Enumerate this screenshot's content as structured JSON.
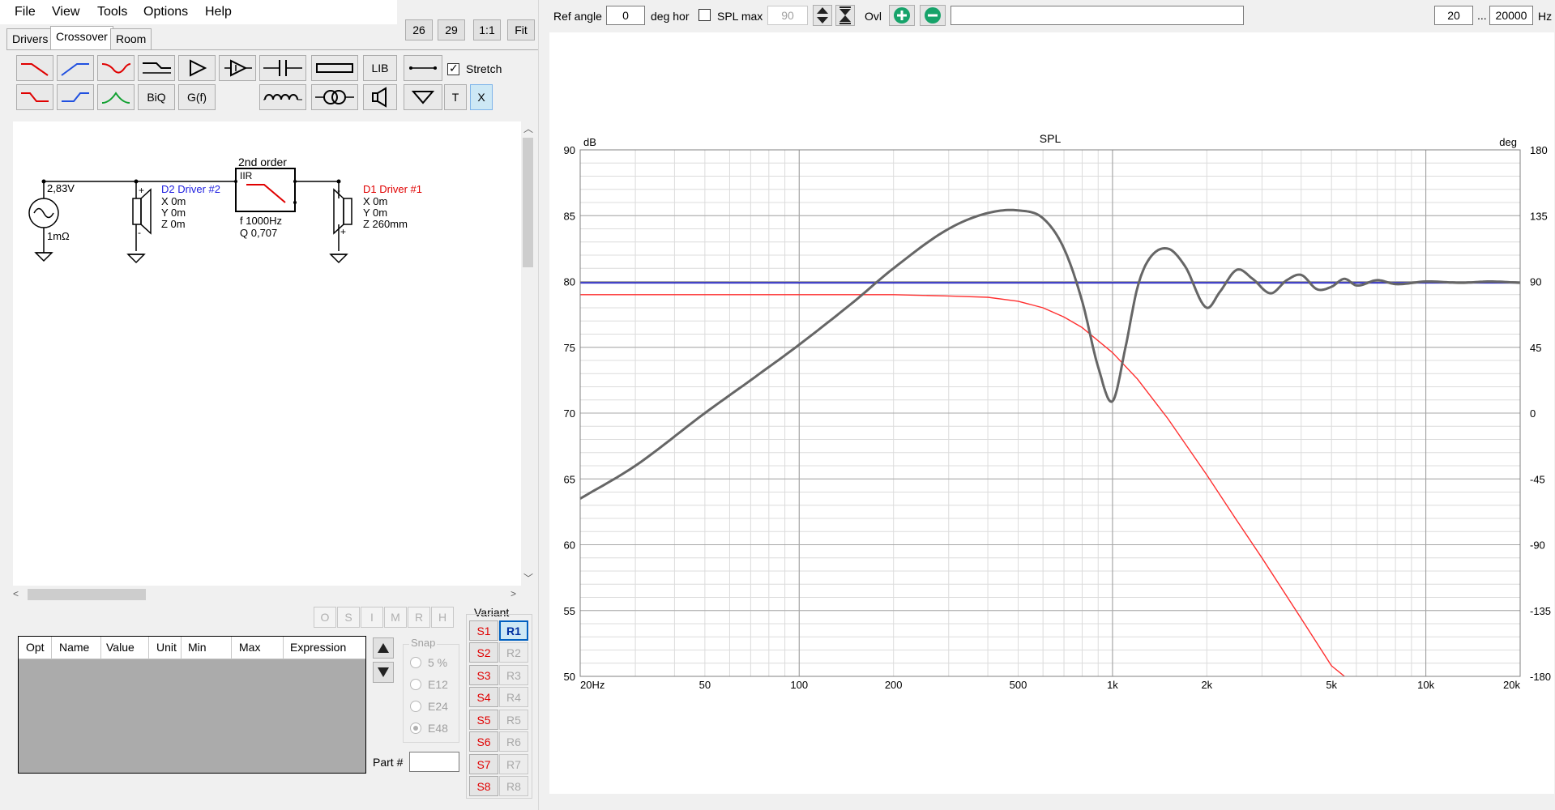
{
  "menu": [
    "File",
    "View",
    "Tools",
    "Options",
    "Help"
  ],
  "tabs": [
    "Drivers",
    "Crossover",
    "Room"
  ],
  "top_buttons": {
    "b26": "26",
    "b29": "29",
    "one_to_one": "1:1",
    "fit": "Fit"
  },
  "toolbar": {
    "lib": "LIB",
    "stretch_label": "Stretch",
    "biq": "BiQ",
    "gf": "G(f)",
    "t": "T",
    "x": "X"
  },
  "schematic": {
    "order_label": "2nd order",
    "voltage": "2,83V",
    "source_res": "1mΩ",
    "driver2": {
      "name": "D2 Driver #2",
      "x": "X 0m",
      "y": "Y 0m",
      "z": "Z 0m"
    },
    "iir": {
      "label": "IIR",
      "f": "f  1000Hz",
      "q": "Q 0,707"
    },
    "driver1": {
      "name": "D1 Driver #1",
      "x": "X 0m",
      "y": "Y 0m",
      "z": "Z 260mm"
    }
  },
  "opt_buttons": [
    "O",
    "S",
    "I",
    "M",
    "R",
    "H"
  ],
  "param_table": {
    "headers": [
      "Opt",
      "Name",
      "Value",
      "Unit",
      "Min",
      "Max",
      "Expression"
    ]
  },
  "snap": {
    "title": "Snap",
    "options": [
      "5 %",
      "E12",
      "E24",
      "E48"
    ],
    "selected": "E48"
  },
  "part_label": "Part #",
  "variant": {
    "title": "Variant",
    "s": [
      "S1",
      "S2",
      "S3",
      "S4",
      "S5",
      "S6",
      "S7",
      "S8"
    ],
    "r": [
      "R1",
      "R2",
      "R3",
      "R4",
      "R5",
      "R6",
      "R7",
      "R8"
    ],
    "active_r": "R1"
  },
  "graph_toolbar": {
    "ref_angle_label": "Ref angle",
    "ref_angle_value": "0",
    "deg_hor_label": "deg hor",
    "spl_max_label": "SPL max",
    "spl_max_value": "90",
    "ovl_label": "Ovl",
    "freq_from": "20",
    "freq_sep": "...",
    "freq_to": "20000",
    "hz_label": "Hz"
  },
  "colors": {
    "spl_gray": "#666666",
    "blue": "#3030c0",
    "red": "#ff3030",
    "driver1": "#e00000",
    "driver2": "#2020e0"
  },
  "chart_data": {
    "type": "line",
    "title": "SPL",
    "ylabel": "dB",
    "y2label": "deg",
    "x_scale": "log",
    "xlim": [
      20,
      20000
    ],
    "ylim": [
      50,
      90
    ],
    "y2lim": [
      -180,
      180
    ],
    "x_ticks": [
      20,
      50,
      100,
      200,
      500,
      1000,
      2000,
      5000,
      10000,
      20000
    ],
    "x_tick_labels": [
      "20Hz",
      "50",
      "100",
      "200",
      "500",
      "1k",
      "2k",
      "5k",
      "10k",
      "20k"
    ],
    "y_ticks": [
      50,
      55,
      60,
      65,
      70,
      75,
      80,
      85,
      90
    ],
    "y_tick_labels": [
      "50",
      "55",
      "60",
      "65",
      "70",
      "75",
      "80",
      "85",
      "90"
    ],
    "y2_ticks": [
      -180,
      -135,
      -90,
      -45,
      0,
      45,
      90,
      135,
      180
    ],
    "y2_tick_labels": [
      "-180",
      "-135",
      "-90",
      "-45",
      "0",
      "45",
      "90",
      "135",
      "180"
    ],
    "grid": true,
    "series": [
      {
        "color": "#3030c0",
        "x": [
          20,
          20000
        ],
        "y": [
          79.9,
          79.9
        ]
      },
      {
        "color": "#ff3030",
        "x": [
          20,
          100,
          200,
          300,
          400,
          500,
          600,
          700,
          800,
          1000,
          1200,
          1500,
          2000,
          2500,
          3000,
          4000,
          5000,
          5500
        ],
        "y": [
          79.0,
          79.0,
          79.0,
          78.9,
          78.8,
          78.5,
          78.0,
          77.3,
          76.5,
          74.6,
          72.6,
          69.6,
          65.3,
          61.8,
          59.0,
          54.4,
          50.8,
          49.5
        ]
      },
      {
        "color": "#666666",
        "x": [
          20,
          30,
          50,
          70,
          100,
          150,
          200,
          300,
          400,
          500,
          600,
          700,
          800,
          900,
          1000,
          1100,
          1200,
          1300,
          1500,
          1700,
          2000,
          2200,
          2500,
          2800,
          3200,
          3600,
          4000,
          4500,
          5000,
          5500,
          6000,
          7000,
          8000,
          10000,
          13000,
          16000,
          20000
        ],
        "y": [
          63.5,
          66.0,
          70.0,
          72.5,
          75.2,
          78.5,
          81.0,
          84.0,
          85.2,
          85.4,
          84.8,
          82.5,
          78.5,
          73.5,
          70.9,
          75.0,
          79.5,
          81.6,
          82.5,
          81.2,
          78.0,
          79.2,
          80.9,
          80.2,
          79.1,
          80.1,
          80.5,
          79.4,
          79.6,
          80.2,
          79.7,
          80.1,
          79.8,
          80.0,
          79.9,
          80.0,
          79.9
        ]
      }
    ]
  }
}
